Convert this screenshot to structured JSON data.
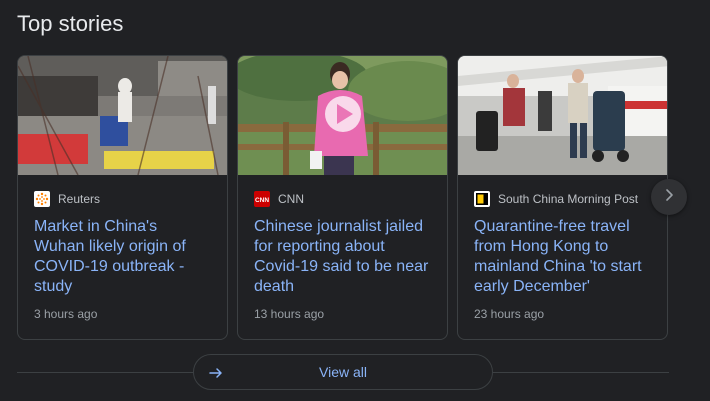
{
  "section": {
    "title": "Top stories"
  },
  "stories": [
    {
      "source": "Reuters",
      "source_icon": "reuters-logo-icon",
      "headline": "Market in China's Wuhan likely origin of COVID-19 outbreak - study",
      "time": "3 hours ago"
    },
    {
      "source": "CNN",
      "source_icon": "cnn-logo-icon",
      "headline": "Chinese journalist jailed for reporting about Covid-19 said to be near death",
      "time": "13 hours ago",
      "has_video": true
    },
    {
      "source": "South China Morning Post",
      "source_icon": "scmp-logo-icon",
      "headline": "Quarantine-free travel from Hong Kong to mainland China 'to start early December'",
      "time": "23 hours ago"
    }
  ],
  "carousel": {
    "next_icon": "chevron-right-icon"
  },
  "footer": {
    "view_all_label": "View all",
    "view_all_icon": "arrow-right-icon"
  },
  "colors": {
    "background": "#202124",
    "headline": "#8ab4f8",
    "source_text": "#bdc1c6",
    "time_text": "#9aa0a6",
    "border": "#3c4043",
    "reuters": "#ff8000",
    "cnn": "#cc0000",
    "scmp": "#ffca05"
  }
}
